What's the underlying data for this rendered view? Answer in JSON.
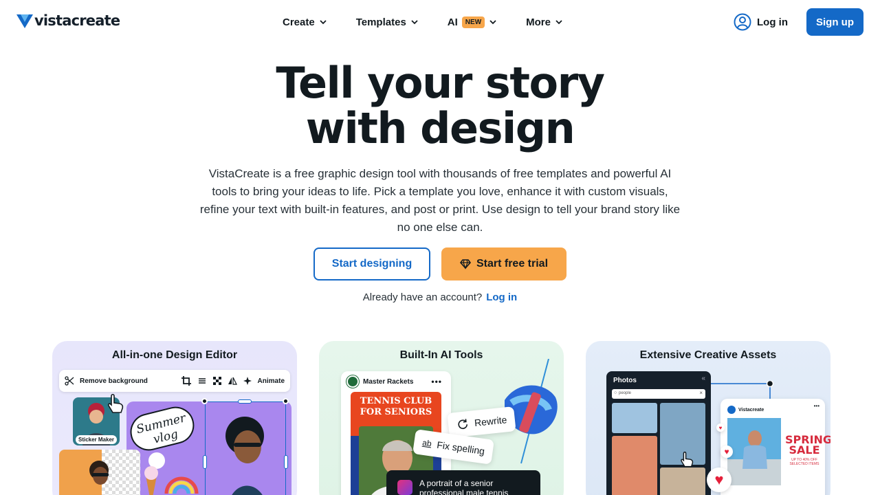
{
  "header": {
    "logo_text": "vistacreate",
    "nav": [
      {
        "label": "Create"
      },
      {
        "label": "Templates"
      },
      {
        "label": "AI",
        "badge": "NEW"
      },
      {
        "label": "More"
      }
    ],
    "login_label": "Log in",
    "signup_label": "Sign up"
  },
  "hero": {
    "title_line1": "Tell your story",
    "title_line2": "with design",
    "description": "VistaCreate is a free graphic design tool with thousands of free templates and powerful AI tools to bring your ideas to life. Pick a template you love, enhance it with custom visuals, refine your text with built-in features, and post or print. Use design to tell your brand story like no one else can.",
    "start_designing_label": "Start designing",
    "start_trial_label": "Start free trial",
    "account_prompt": "Already have an account?",
    "account_login_label": "Log in"
  },
  "cards": [
    {
      "title": "All-in-one Design Editor",
      "toolbar": {
        "remove_bg_label": "Remove background",
        "animate_label": "Animate"
      },
      "sticker_label": "Sticker Maker"
    },
    {
      "title": "Built-In AI Tools",
      "post_account": "Master Rackets",
      "post_headline_1": "TENNIS CLUB",
      "post_headline_2": "FOR SENIORS",
      "rewrite_label": "Rewrite",
      "fix_spelling_label": "Fix spelling",
      "prompt_text": "A portrait of a senior professional male tennis"
    },
    {
      "title": "Extensive Creative Assets",
      "panel_title": "Photos",
      "search_value": "people",
      "post_account": "Vistacreate",
      "sale_line1": "SPRING",
      "sale_line2": "SALE",
      "sale_sub": "UP TO 40% OFF SELECTED ITEMS"
    }
  ],
  "colors": {
    "brand_blue": "#1469c7",
    "accent_orange": "#f7a64a",
    "text_dark": "#121a1f"
  }
}
